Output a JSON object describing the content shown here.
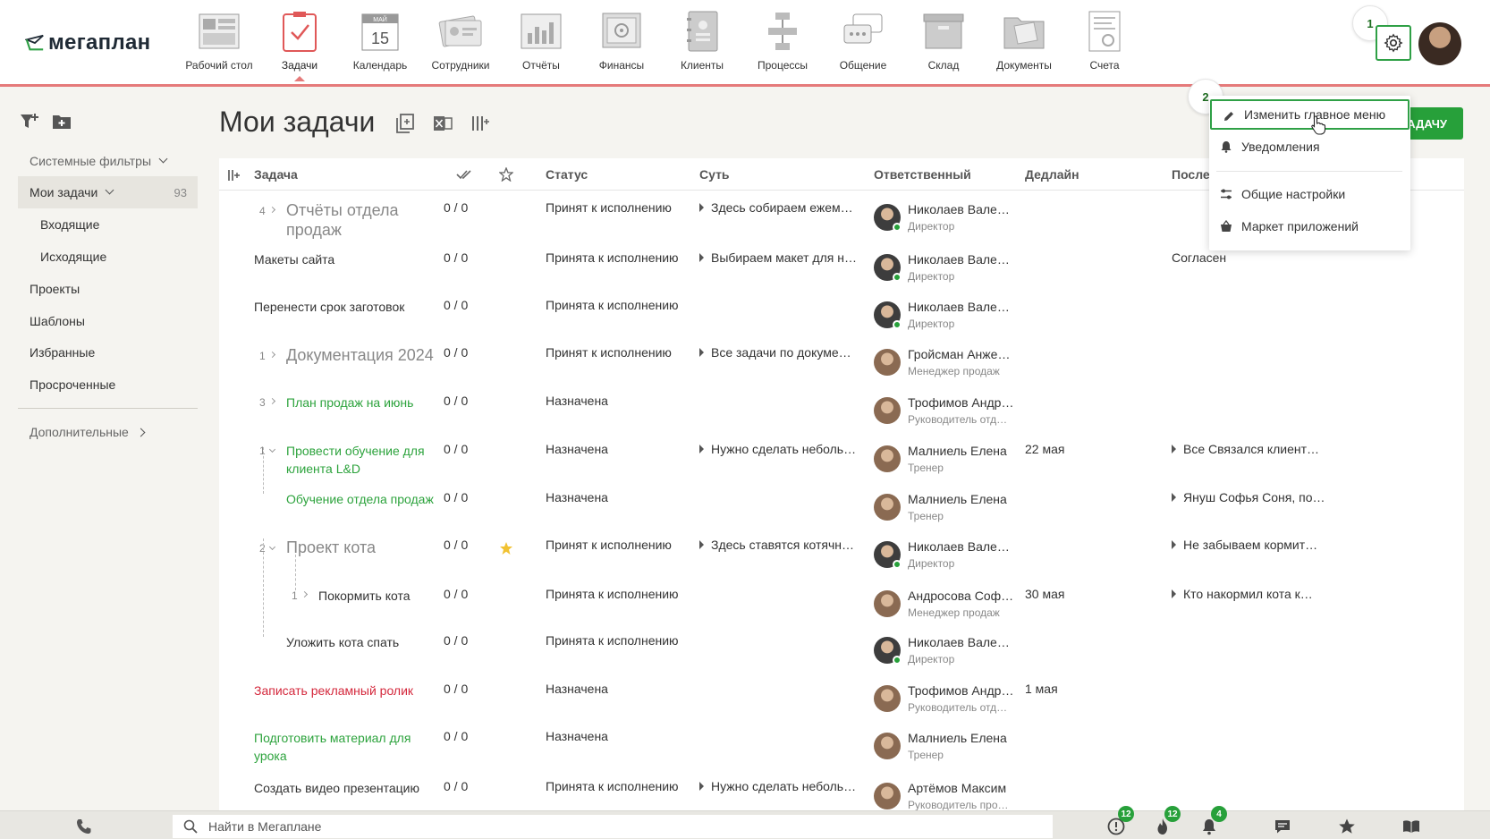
{
  "app": {
    "logo_text": "мегаплан"
  },
  "nav": {
    "items": [
      {
        "label": "Рабочий стол",
        "icon": "desktop-icon"
      },
      {
        "label": "Задачи",
        "icon": "tasks-icon"
      },
      {
        "label": "Календарь",
        "icon": "calendar-icon",
        "calendar_day": "15",
        "calendar_month": "МАЙ"
      },
      {
        "label": "Сотрудники",
        "icon": "employees-icon"
      },
      {
        "label": "Отчёты",
        "icon": "reports-icon"
      },
      {
        "label": "Финансы",
        "icon": "finance-icon"
      },
      {
        "label": "Клиенты",
        "icon": "clients-icon"
      },
      {
        "label": "Процессы",
        "icon": "processes-icon"
      },
      {
        "label": "Общение",
        "icon": "chat-icon"
      },
      {
        "label": "Склад",
        "icon": "warehouse-icon"
      },
      {
        "label": "Документы",
        "icon": "documents-icon"
      },
      {
        "label": "Счета",
        "icon": "invoices-icon"
      }
    ],
    "active_index": 1
  },
  "steps": {
    "one": "1",
    "two": "2"
  },
  "sidebar": {
    "system_filters": "Системные фильтры",
    "my_tasks": "Мои задачи",
    "my_tasks_count": "93",
    "incoming": "Входящие",
    "outgoing": "Исходящие",
    "projects": "Проекты",
    "templates": "Шаблоны",
    "favorites": "Избранные",
    "overdue": "Просроченные",
    "additional": "Дополнительные"
  },
  "page": {
    "title": "Мои задачи",
    "add_button": "ЗАДАЧУ"
  },
  "table": {
    "headers": {
      "task": "Задача",
      "status": "Статус",
      "essence": "Суть",
      "responsible": "Ответственный",
      "deadline": "Дедлайн",
      "last": "После"
    },
    "rows": [
      {
        "count": "4",
        "name_lines": [
          "Отчёты отдела",
          "продаж"
        ],
        "style": "big",
        "progress": "0 / 0",
        "status": "Принят к исполнению",
        "essence": "Здесь собираем ежем…",
        "person": "Николаев Вале…",
        "role": "Директор",
        "online": true,
        "deadline": "",
        "last": ""
      },
      {
        "count": "",
        "name_lines": [
          "Макеты сайта"
        ],
        "style": "normal",
        "progress": "0 / 0",
        "status": "Принята к исполнению",
        "essence": "Выбираем макет для н…",
        "person": "Николаев Вале…",
        "role": "Директор",
        "online": true,
        "deadline": "",
        "last": "Согласен"
      },
      {
        "count": "",
        "name_lines": [
          "Перенести срок заготовок"
        ],
        "style": "normal",
        "progress": "0 / 0",
        "status": "Принята к исполнению",
        "essence": "",
        "person": "Николаев Вале…",
        "role": "Директор",
        "online": true,
        "deadline": "",
        "last": ""
      },
      {
        "count": "1",
        "name_lines": [
          "Документация 2024"
        ],
        "style": "big",
        "progress": "0 / 0",
        "status": "Принят к исполнению",
        "essence": "Все задачи по докуме…",
        "person": "Гройсман Анже…",
        "role": "Менеджер продаж",
        "online": false,
        "deadline": "",
        "last": ""
      },
      {
        "count": "3",
        "name_lines": [
          "План продаж на июнь"
        ],
        "style": "green",
        "progress": "0 / 0",
        "status": "Назначена",
        "essence": "",
        "person": "Трофимов Андр…",
        "role": "Руководитель отд…",
        "online": false,
        "deadline": "",
        "last": ""
      },
      {
        "count": "1",
        "name_lines": [
          "Провести обучение для",
          "клиента L&D"
        ],
        "style": "green",
        "progress": "0 / 0",
        "status": "Назначена",
        "essence": "Нужно сделать неболь…",
        "person": "Малниель Елена",
        "role": "Тренер",
        "online": false,
        "deadline": "22 мая",
        "last": "Все Связался клиент…"
      },
      {
        "count": "",
        "name_lines": [
          "Обучение отдела продаж"
        ],
        "style": "green",
        "progress": "0 / 0",
        "status": "Назначена",
        "essence": "",
        "person": "Малниель Елена",
        "role": "Тренер",
        "online": false,
        "deadline": "",
        "last": "Януш Софья Соня, по…"
      },
      {
        "count": "2",
        "name_lines": [
          "Проект кота"
        ],
        "style": "big",
        "progress": "0 / 0",
        "status": "Принят к исполнению",
        "essence": "Здесь ставятся котячн…",
        "person": "Николаев Вале…",
        "role": "Директор",
        "online": true,
        "deadline": "",
        "last": "Не забываем кормит…",
        "starred": true
      },
      {
        "count": "1",
        "name_lines": [
          "Покормить кота"
        ],
        "style": "normal",
        "progress": "0 / 0",
        "status": "Принята к исполнению",
        "essence": "",
        "person": "Андросова Соф…",
        "role": "Менеджер продаж",
        "online": false,
        "deadline": "30 мая",
        "last": "Кто накормил кота к…"
      },
      {
        "count": "",
        "name_lines": [
          "Уложить кота спать"
        ],
        "style": "normal",
        "progress": "0 / 0",
        "status": "Принята к исполнению",
        "essence": "",
        "person": "Николаев Вале…",
        "role": "Директор",
        "online": true,
        "deadline": "",
        "last": ""
      },
      {
        "count": "",
        "name_lines": [
          "Записать рекламный ролик"
        ],
        "style": "red",
        "progress": "0 / 0",
        "status": "Назначена",
        "essence": "",
        "person": "Трофимов Андр…",
        "role": "Руководитель отд…",
        "online": false,
        "deadline": "1 мая",
        "last": ""
      },
      {
        "count": "",
        "name_lines": [
          "Подготовить материал для",
          "урока"
        ],
        "style": "green",
        "progress": "0 / 0",
        "status": "Назначена",
        "essence": "",
        "person": "Малниель Елена",
        "role": "Тренер",
        "online": false,
        "deadline": "",
        "last": ""
      },
      {
        "count": "",
        "name_lines": [
          "Создать видео презентацию"
        ],
        "style": "normal",
        "progress": "0 / 0",
        "status": "Принята к исполнению",
        "essence": "Нужно сделать неболь…",
        "person": "Артёмов Максим",
        "role": "Руководитель про…",
        "online": false,
        "deadline": "",
        "last": ""
      }
    ]
  },
  "dropdown": {
    "edit_menu": "Изменить главное меню",
    "notifications": "Уведомления",
    "general_settings": "Общие настройки",
    "app_market": "Маркет приложений"
  },
  "bottom": {
    "search_placeholder": "Найти в Мегаплане",
    "badge_alerts": "12",
    "badge_hot": "12",
    "badge_notifications": "4"
  },
  "colors": {
    "accent_green": "#27a03a",
    "nav_underline": "#e57a7a",
    "overdue_red": "#d4283c"
  }
}
